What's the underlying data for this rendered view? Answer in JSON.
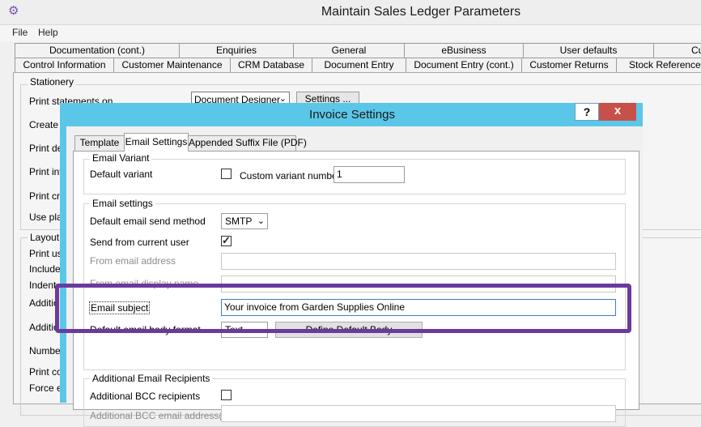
{
  "window": {
    "title": "Maintain Sales Ledger Parameters",
    "app_icon": "gear-icon",
    "menu": [
      "File",
      "Help"
    ]
  },
  "tabs_row1": [
    "Documentation (cont.)",
    "Enquiries",
    "General",
    "eBusiness",
    "User defaults",
    "Cu"
  ],
  "tabs_row2": [
    "Control Information",
    "Customer Maintenance",
    "CRM Database",
    "Document Entry",
    "Document Entry (cont.)",
    "Customer Returns",
    "Stock Reference F"
  ],
  "main": {
    "stationery_title": "Stationery",
    "print_statements_label": "Print statements on",
    "stationery_value": "Document Designer",
    "settings_label": "Settings ...",
    "create_label": "Create c",
    "print_del_label": "Print deli",
    "print_inv_label": "Print invo",
    "print_cre_label": "Print cre",
    "use_plain_label": "Use plai",
    "layout_title": "Layout &",
    "print_using_label": "Print usi",
    "include_label": "Include",
    "indent_label": "Indent a",
    "addition1_label": "Additio",
    "addition2_label": "Additio",
    "number_label": "Number",
    "print_com_label": "Print con",
    "force_label": "Force er"
  },
  "dialog": {
    "title": "Invoice Settings",
    "help_label": "?",
    "close_label": "x",
    "tabs": [
      "Template",
      "Email Settings",
      "Appended Suffix File (PDF)"
    ],
    "email_variant": {
      "title": "Email Variant",
      "default_variant_label": "Default variant",
      "default_variant_checked": false,
      "custom_variant_label": "Custom variant number",
      "custom_variant_value": "1"
    },
    "email_settings": {
      "title": "Email settings",
      "send_method_label": "Default email send method",
      "send_method_value": "SMTP",
      "send_from_user_label": "Send from current user",
      "send_from_user_checked": true,
      "from_address_label": "From email address",
      "from_address_value": "",
      "from_display_label": "From email display name",
      "from_display_value": "",
      "subject_label": "Email subject",
      "subject_value": "Your invoice from Garden Supplies Online",
      "body_format_label": "Default email body format",
      "body_format_value": "Text",
      "define_body_label": "Define Default Body"
    },
    "additional": {
      "title": "Additional Email Recipients",
      "bcc_label": "Additional BCC recipients",
      "bcc_checked": false,
      "bcc_address_label": "Additional BCC email address(es)"
    }
  },
  "colors": {
    "dialog_frame": "#5bc7e8",
    "close_button": "#c7504a",
    "highlight": "#6a3a9c"
  }
}
